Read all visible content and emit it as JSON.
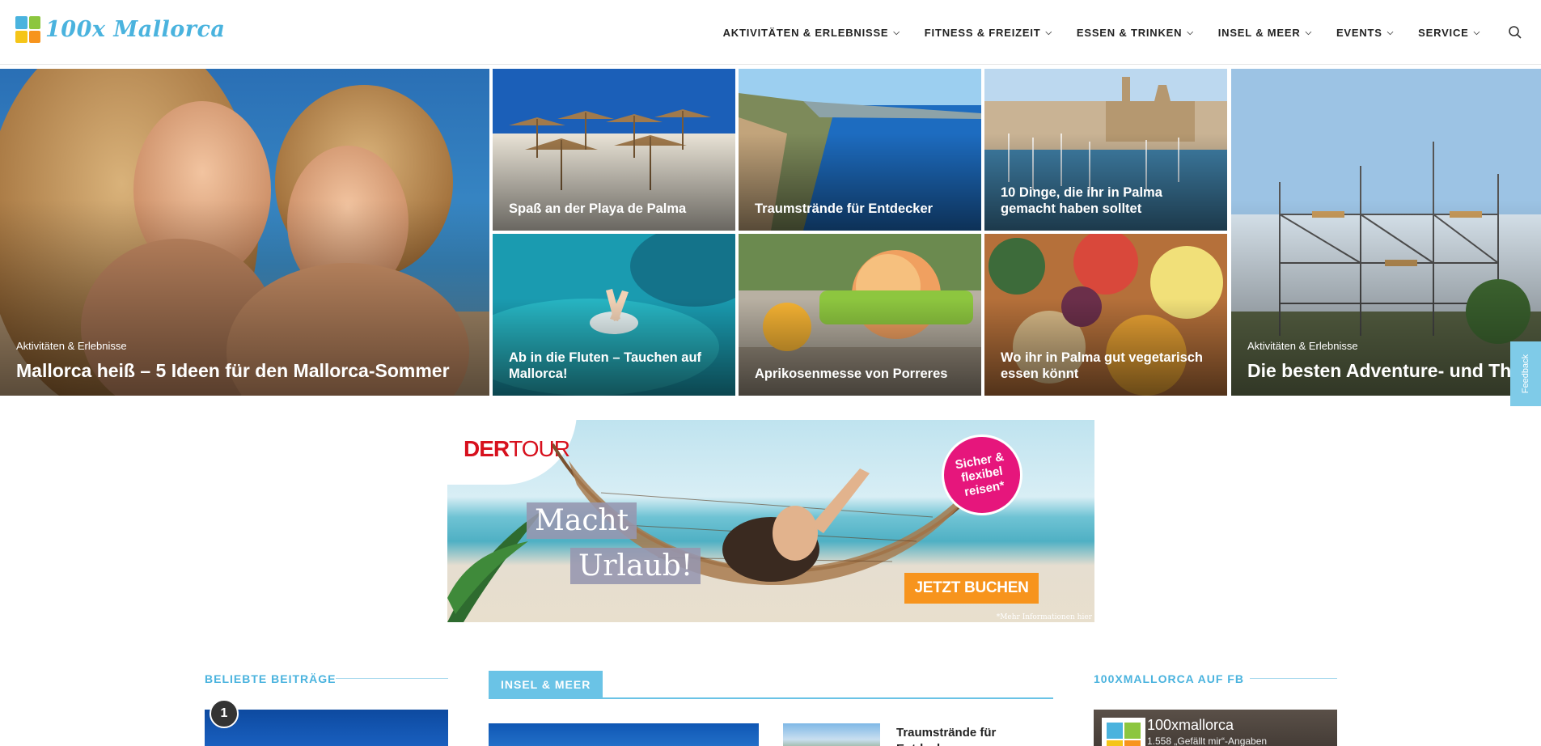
{
  "site": {
    "logo_text": "100x Mallorca",
    "logo_colors": [
      "#4ab3de",
      "#8cc63f",
      "#f7941d",
      "#f5c518"
    ]
  },
  "nav": {
    "items": [
      {
        "label": "AKTIVITÄTEN & ERLEBNISSE"
      },
      {
        "label": "FITNESS & FREIZEIT"
      },
      {
        "label": "ESSEN & TRINKEN"
      },
      {
        "label": "INSEL & MEER"
      },
      {
        "label": "EVENTS"
      },
      {
        "label": "SERVICE"
      }
    ],
    "search_icon": "search-icon"
  },
  "hero": {
    "featured_left": {
      "category": "Aktivitäten & Erlebnisse",
      "title": "Mallorca heiß – 5 Ideen für den Mallorca-Sommer"
    },
    "tiles": [
      {
        "title": "Spaß an der Playa de Palma"
      },
      {
        "title": "Traumstrände für Entdecker"
      },
      {
        "title": "10 Dinge, die ihr in Palma gemacht haben solltet"
      },
      {
        "title": "Ab in die Fluten – Tauchen auf Mallorca!"
      },
      {
        "title": "Aprikosenmesse von Porreres"
      },
      {
        "title": "Wo ihr in Palma gut vegetarisch essen könnt"
      }
    ],
    "featured_right": {
      "category": "Aktivitäten & Erlebnisse",
      "title": "Die besten Adventure- und Themenparks"
    }
  },
  "feedback": {
    "label": "Feedback"
  },
  "ad": {
    "brand_der": "DER",
    "brand_tour": "TOUR",
    "headline_1": "Macht",
    "headline_2": "Urlaub!",
    "badge": "Sicher & flexibel reisen*",
    "cta": "JETZT BUCHEN",
    "note": "*Mehr Informationen hier"
  },
  "sections": {
    "popular": {
      "title": "BELIEBTE BEITRÄGE",
      "badge": "1"
    },
    "island": {
      "title": "INSEL & MEER",
      "item_title": "Traumstrände für Entdecker"
    },
    "facebook": {
      "title": "100XMALLORCA AUF FB",
      "page_name": "100xmallorca",
      "likes": "1.558 „Gefällt mir“-Angaben"
    }
  }
}
